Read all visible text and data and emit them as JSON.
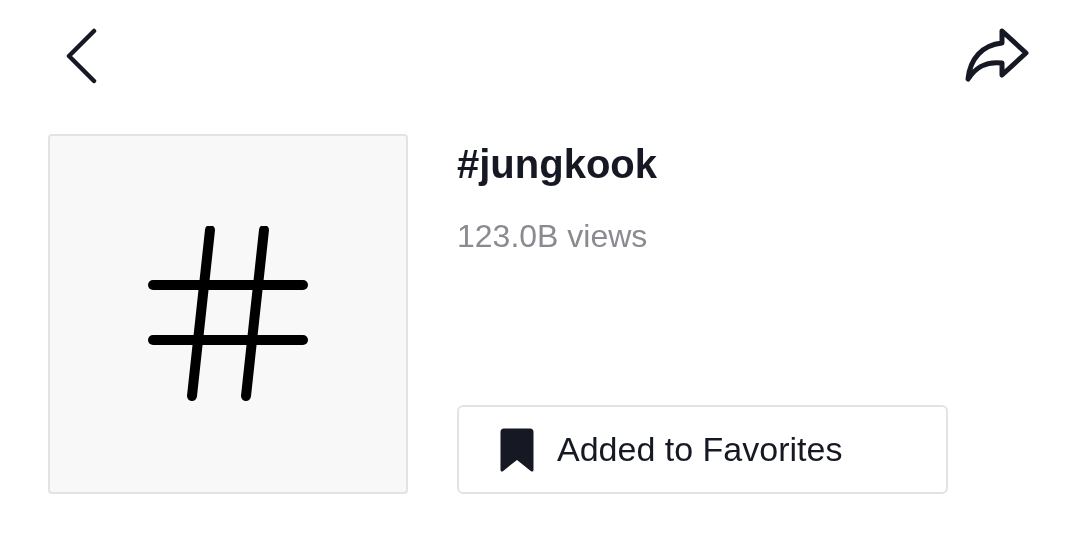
{
  "hashtag": {
    "title": "#jungkook",
    "views": "123.0B views"
  },
  "favorite_button": {
    "label": "Added to Favorites",
    "saved": true
  }
}
